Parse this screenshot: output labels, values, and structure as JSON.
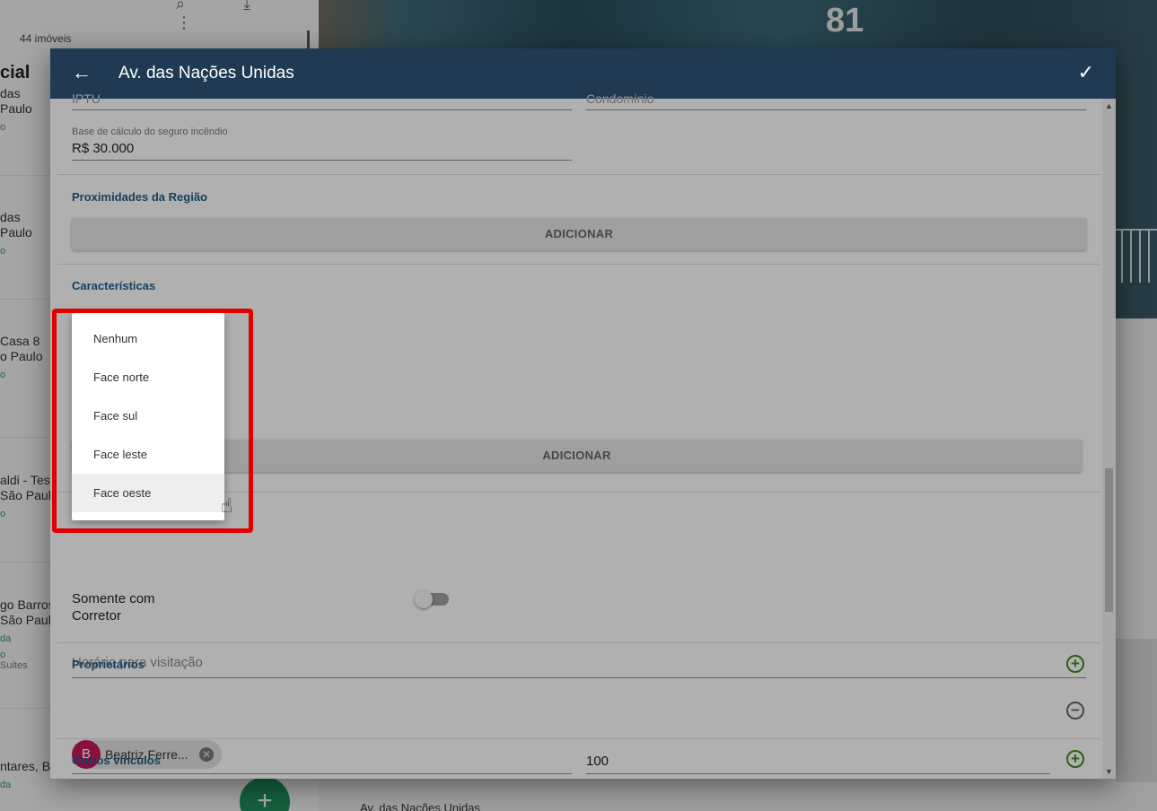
{
  "background": {
    "count_label": "44 imóveis",
    "list_title": "cial",
    "items": [
      {
        "line1": "das",
        "line2": "Paulo",
        "tag": "o",
        "sub": ""
      },
      {
        "line1": "das",
        "line2": "Paulo",
        "tag": "o",
        "sub": ""
      },
      {
        "line1": "Casa 8",
        "line2": "o Paulo",
        "tag": "o",
        "sub": ""
      },
      {
        "line1": "aldi - Test",
        "line2": "São Paulo",
        "tag": "o",
        "sub": ""
      },
      {
        "line1": "go Barros",
        "line2": "São Paulo",
        "tag": "da",
        "sub": "o"
      },
      {
        "line1": "ntares, Br",
        "line2": "",
        "tag": "da",
        "sub": ""
      }
    ],
    "suites_label": "Suites",
    "fab_label": "+",
    "photo_number": "81",
    "bottom_text": "Av. das Nações Unidas"
  },
  "dialog": {
    "title": "Av. das Nações Unidas",
    "back_icon": "←",
    "confirm_icon": "✓",
    "partial_left_value": "IPTU",
    "partial_right_value": "Condomínio",
    "insurance": {
      "label": "Base de cálculo do seguro incêndio",
      "value": "R$ 30.000"
    },
    "proximities": {
      "title": "Proximidades da Região",
      "add_label": "ADICIONAR"
    },
    "characteristics": {
      "title": "Características",
      "add_label": "ADICIONAR"
    },
    "broker_only": {
      "label": "Somente com Corretor",
      "checked": false
    },
    "visit_hours": {
      "placeholder": "Horário para visitação"
    },
    "owners": {
      "title": "Proprietários",
      "chip": {
        "initial": "B",
        "name": "Beatriz Ferre..."
      },
      "percentage": "100"
    },
    "other_links": {
      "title": "Outros vínculos"
    }
  },
  "dropdown": {
    "options": [
      "Nenhum",
      "Face norte",
      "Face sul",
      "Face leste",
      "Face oeste"
    ],
    "hovered": "Face oeste"
  },
  "colors": {
    "header": "#1f3a52",
    "section_title": "#1f5c8a",
    "highlight": "#e10000",
    "add_green": "#3b8c1e",
    "avatar": "#c2185b"
  }
}
